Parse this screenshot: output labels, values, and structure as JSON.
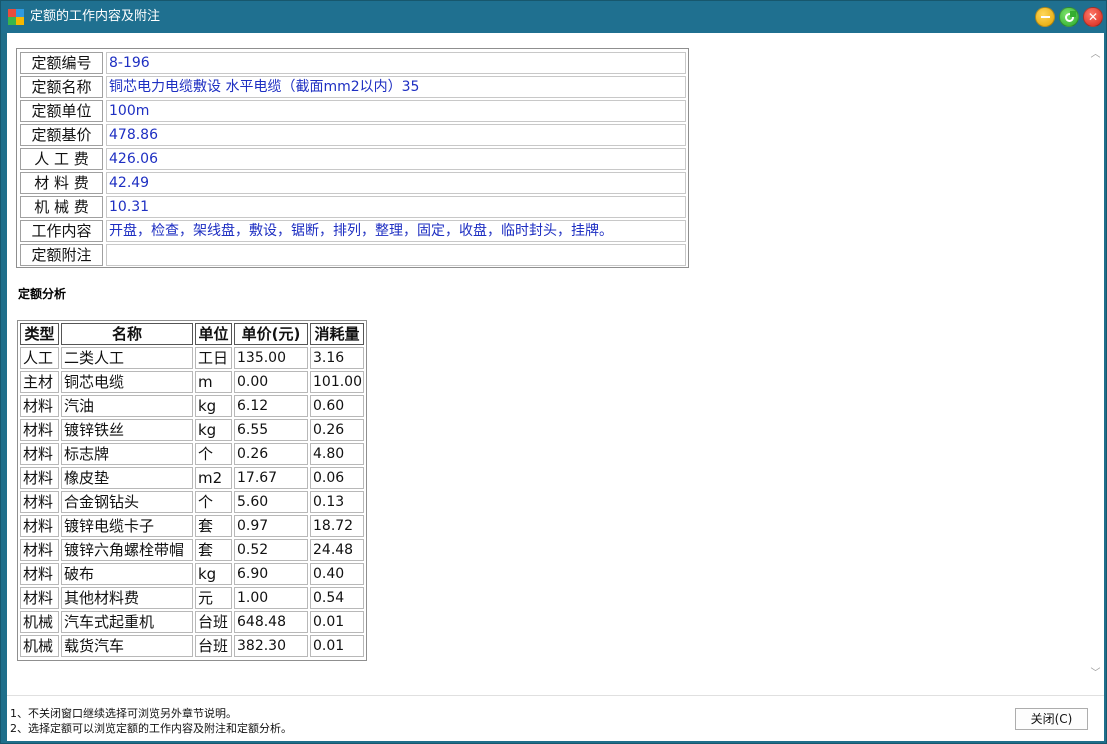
{
  "window": {
    "title": "定额的工作内容及附注"
  },
  "info": [
    {
      "label": "定额编号",
      "value": "8-196"
    },
    {
      "label": "定额名称",
      "value": "铜芯电力电缆敷设 水平电缆（截面mm2以内）35"
    },
    {
      "label": "定额单位",
      "value": "100m"
    },
    {
      "label": "定额基价",
      "value": "478.86"
    },
    {
      "label": "人 工 费",
      "value": "426.06"
    },
    {
      "label": "材 料 费",
      "value": "42.49"
    },
    {
      "label": "机 械 费",
      "value": "10.31"
    },
    {
      "label": "工作内容",
      "value": "开盘，检查，架线盘，敷设，锯断，排列，整理，固定，收盘，临时封头，挂牌。"
    },
    {
      "label": "定额附注",
      "value": ""
    }
  ],
  "analysis": {
    "title": "定额分析",
    "headers": [
      "类型",
      "名称",
      "单位",
      "单价(元)",
      "消耗量"
    ],
    "rows": [
      [
        "人工",
        "二类人工",
        "工日",
        "135.00",
        "3.16"
      ],
      [
        "主材",
        "铜芯电缆",
        "m",
        "0.00",
        "101.00"
      ],
      [
        "材料",
        "汽油",
        "kg",
        "6.12",
        "0.60"
      ],
      [
        "材料",
        "镀锌铁丝",
        "kg",
        "6.55",
        "0.26"
      ],
      [
        "材料",
        "标志牌",
        "个",
        "0.26",
        "4.80"
      ],
      [
        "材料",
        "橡皮垫",
        "m2",
        "17.67",
        "0.06"
      ],
      [
        "材料",
        "合金钢钻头",
        "个",
        "5.60",
        "0.13"
      ],
      [
        "材料",
        "镀锌电缆卡子",
        "套",
        "0.97",
        "18.72"
      ],
      [
        "材料",
        "镀锌六角螺栓带帽",
        "套",
        "0.52",
        "24.48"
      ],
      [
        "材料",
        "破布",
        "kg",
        "6.90",
        "0.40"
      ],
      [
        "材料",
        "其他材料费",
        "元",
        "1.00",
        "0.54"
      ],
      [
        "机械",
        "汽车式起重机",
        "台班",
        "648.48",
        "0.01"
      ],
      [
        "机械",
        "载货汽车",
        "台班",
        "382.30",
        "0.01"
      ]
    ]
  },
  "footer": {
    "note1": "1、不关闭窗口继续选择可浏览另外章节说明。",
    "note2": "2、选择定额可以浏览定额的工作内容及附注和定额分析。",
    "close_label": "关闭(C)"
  }
}
